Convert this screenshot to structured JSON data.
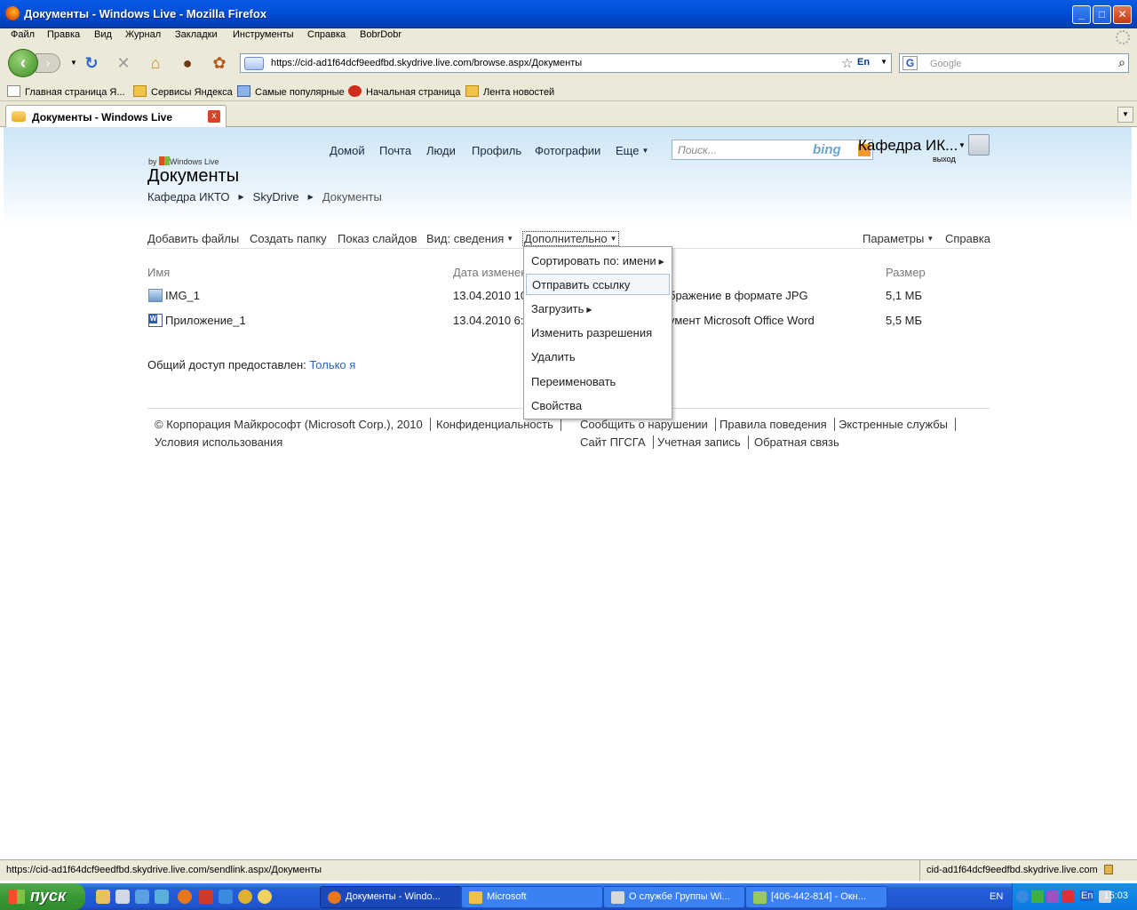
{
  "window": {
    "title": "Документы - Windows Live - Mozilla Firefox",
    "min": "_",
    "max": "□",
    "close": "✕"
  },
  "menubar": [
    "Файл",
    "Правка",
    "Вид",
    "Журнал",
    "Закладки",
    "Инструменты",
    "Справка",
    "BobrDobr"
  ],
  "navbar": {
    "url": "https://cid-ad1f64dcf9eedfbd.skydrive.live.com/browse.aspx/Документы",
    "lang_badge": "En",
    "search_placeholder": "Google",
    "search_engine_icon": "G"
  },
  "bookmarks": [
    "Главная страница Я...",
    "Сервисы Яндекса",
    "Самые популярные",
    "Начальная страница",
    "Лента новостей"
  ],
  "tab": {
    "title": "Документы - Windows Live",
    "close": "x"
  },
  "site": {
    "nav": [
      "Домой",
      "Почта",
      "Люди",
      "Профиль",
      "Фотографии",
      "Еще"
    ],
    "search_placeholder": "Поиск...",
    "search_brand": "bing",
    "user_name": "Кафедра ИК...",
    "logout": "выход",
    "byline_prefix": "by",
    "byline_brand": "Windows Live",
    "page_title": "Документы",
    "breadcrumb": [
      "Кафедра ИКТО",
      "SkyDrive",
      "Документы"
    ]
  },
  "toolbar": {
    "add_files": "Добавить файлы",
    "create_folder": "Создать папку",
    "slideshow": "Показ слайдов",
    "view": "Вид: сведения",
    "more": "Дополнительно",
    "settings": "Параметры",
    "help": "Справка"
  },
  "table": {
    "headers": {
      "name": "Имя",
      "date": "Дата изменен",
      "size": "Размер"
    },
    "rows": [
      {
        "name": "IMG_1",
        "date": "13.04.2010 10",
        "type": "бражение в формате JPG",
        "size": "5,1 МБ"
      },
      {
        "name": "Приложение_1",
        "date": "13.04.2010 6:",
        "type": "умент Microsoft Office Word",
        "size": "5,5 МБ"
      }
    ]
  },
  "shared": {
    "label": "Общий доступ предоставлен:",
    "value": "Только я"
  },
  "footer": {
    "copyright": "© Корпорация Майкрософт (Microsoft Corp.), 2010",
    "privacy": "Конфиденциальность",
    "terms": "Условия использования",
    "report": "Сообщить о нарушении",
    "rules": "Правила поведения",
    "emergency": "Экстренные службы",
    "site": "Сайт ПГСГА",
    "account": "Учетная запись",
    "feedback": "Обратная связь"
  },
  "dropdown": {
    "items": [
      "Сортировать по: имени",
      "Отправить ссылку",
      "Загрузить",
      "Изменить разрешения",
      "Удалить",
      "Переименовать",
      "Свойства"
    ],
    "highlighted_index": 1
  },
  "statusbar": {
    "text": "https://cid-ad1f64dcf9eedfbd.skydrive.live.com/sendlink.aspx/Документы",
    "host": "cid-ad1f64dcf9eedfbd.skydrive.live.com"
  },
  "taskbar": {
    "start": "пуск",
    "tasks": [
      "Документы - Windo...",
      "Microsoft",
      "О службе Группы Wi...",
      "[406-442-814] - Окн..."
    ],
    "lang": "EN",
    "tray_lang": "En",
    "clock": "15:03"
  },
  "colors": {
    "link": "#2a6ab8",
    "titlebar": "#0050d8",
    "taskbar": "#245edb",
    "start": "#3a9a36"
  }
}
